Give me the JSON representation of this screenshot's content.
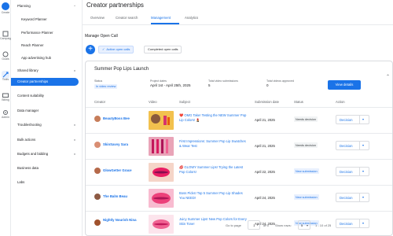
{
  "rail": {
    "labels": [
      "Create",
      "Campaigns",
      "Goals",
      "Tools",
      "Billing",
      "Admin"
    ]
  },
  "nav": {
    "items": [
      {
        "label": "Planning",
        "chevron": "^"
      },
      {
        "label": "Keyword Planner"
      },
      {
        "label": "Performance Planner"
      },
      {
        "label": "Reach Planner"
      },
      {
        "label": "App advertising hub"
      },
      {
        "label": "Shared library",
        "chevron": "v"
      },
      {
        "label": "Creator partnerships"
      },
      {
        "label": "Content suitability"
      },
      {
        "label": "Data manager"
      },
      {
        "label": "Troubleshooting",
        "chevron": "v"
      },
      {
        "label": "Bulk actions",
        "chevron": "v"
      },
      {
        "label": "Budgets and bidding",
        "chevron": "v"
      },
      {
        "label": "Business data"
      },
      {
        "label": "Labs"
      }
    ]
  },
  "header": {
    "title": "Creator partnerships"
  },
  "tabs": [
    "Overview",
    "Creator search",
    "Management",
    "Analytics"
  ],
  "manage": {
    "section_title": "Manage Open Call",
    "add_icon": "+",
    "chip_active": "Active open calls",
    "chip_completed": "Completed open calls"
  },
  "campaign": {
    "title": "Summer Pop Lips Launch",
    "status_label": "Status",
    "status_value": "In video review",
    "dates_label": "Project dates",
    "dates_value": "April 1st - April 25th, 2025",
    "submissions_label": "Total video submissions",
    "submissions_value": "5",
    "approved_label": "Total videos approved",
    "approved_value": "0",
    "view_button": "View details"
  },
  "table": {
    "columns": [
      "Creator",
      "Video",
      "Subject",
      "Submission date",
      "Status",
      "Action"
    ],
    "rows": [
      {
        "creator": "BeautyBoss Bee",
        "subject": "❤️ OMG Take! Testing the NEW Summer Pop Lip Colors! 💄",
        "date": "April 21, 2025",
        "status": "Needs decision",
        "action": "Decision"
      },
      {
        "creator": "SkinSavvy Sara",
        "subject": "First Impressions: Summer Pop Lip Swatches & Wear Test",
        "date": "April 21, 2025",
        "status": "Needs decision",
        "action": "Decision"
      },
      {
        "creator": "GlowGetter Grace",
        "subject": "💋 GLOWY Summer Lips! Trying the Latest Pop Colors!",
        "date": "April 22, 2025",
        "status": "New submission",
        "action": "Decision"
      },
      {
        "creator": "The Balm Beau",
        "subject": "Boss Picks! Top 5 Summer Pop Lip Shades You NEED!",
        "date": "April 24, 2025",
        "status": "New submission",
        "action": "Decision"
      },
      {
        "creator": "Nightly Nourish Nina",
        "subject": "Juicy Summer Lips! New Pop Colors for Every Skin Tone!",
        "date": "April 24, 2025",
        "status": "New submission",
        "action": "Decision"
      }
    ]
  },
  "pager": {
    "go_to_page": "Go to page",
    "page_value": "1",
    "of_pages": "of 5",
    "show_rows": "Show rows:",
    "rows_value": "5",
    "range": "1 - 10 of 25"
  }
}
